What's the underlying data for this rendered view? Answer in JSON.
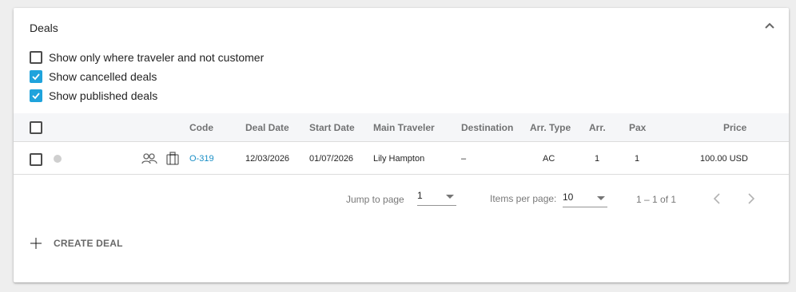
{
  "panel": {
    "title": "Deals"
  },
  "filters": [
    {
      "label": "Show only where traveler and not customer",
      "checked": false
    },
    {
      "label": "Show cancelled deals",
      "checked": true
    },
    {
      "label": "Show published deals",
      "checked": true
    }
  ],
  "table": {
    "columns": [
      "Code",
      "Deal Date",
      "Start Date",
      "Main Traveler",
      "Destination",
      "Arr. Type",
      "Arr.",
      "Pax",
      "Price"
    ],
    "rows": [
      {
        "checked": false,
        "code": "O-319",
        "deal_date": "12/03/2026",
        "start_date": "01/07/2026",
        "main_traveler": "Lily Hampton",
        "destination": "–",
        "arr_type": "AC",
        "arr": "1",
        "pax": "1",
        "price": "100.00 USD",
        "icons": [
          "status-dot-icon",
          "travelers-icon",
          "suitcase-icon"
        ]
      }
    ]
  },
  "pagination": {
    "jump_label": "Jump to page",
    "jump_value": "1",
    "items_label": "Items per page:",
    "items_value": "10",
    "range": "1 – 1 of 1"
  },
  "actions": {
    "create_label": "CREATE DEAL"
  },
  "colors": {
    "accent": "#1fa3dc",
    "link": "#1a8fc6",
    "header_bg": "#f5f6f8"
  }
}
